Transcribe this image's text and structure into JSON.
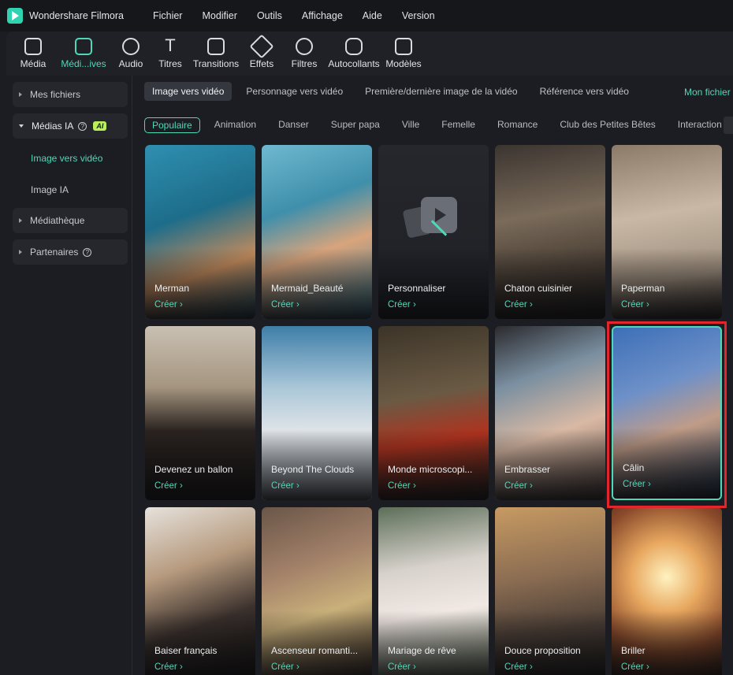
{
  "app": {
    "title": "Wondershare Filmora",
    "accent": "#4fd8b8"
  },
  "menu": [
    "Fichier",
    "Modifier",
    "Outils",
    "Affichage",
    "Aide",
    "Version"
  ],
  "toolbar": [
    {
      "label": "Média",
      "icon": "media-icon"
    },
    {
      "label": "Médi...ives",
      "icon": "stock-media-icon",
      "active": true
    },
    {
      "label": "Audio",
      "icon": "music-note-icon"
    },
    {
      "label": "Titres",
      "icon": "text-icon"
    },
    {
      "label": "Transitions",
      "icon": "transitions-icon"
    },
    {
      "label": "Effets",
      "icon": "effects-icon"
    },
    {
      "label": "Filtres",
      "icon": "filters-icon"
    },
    {
      "label": "Autocollants",
      "icon": "stickers-icon"
    },
    {
      "label": "Modèles",
      "icon": "templates-icon"
    }
  ],
  "sidebar": {
    "mes_fichiers": "Mes fichiers",
    "medias_ia": "Médias IA",
    "ai_badge": "AI",
    "image_vers_video": "Image vers vidéo",
    "image_ia": "Image IA",
    "mediatheque": "Médiathèque",
    "partenaires": "Partenaires",
    "help_glyph": "?"
  },
  "tabs": [
    "Image vers vidéo",
    "Personnage vers vidéo",
    "Première/dernière image de la vidéo",
    "Référence vers vidéo"
  ],
  "tab_right": "Mon fichier",
  "categories": [
    "Populaire",
    "Animation",
    "Danser",
    "Super papa",
    "Ville",
    "Femelle",
    "Romance",
    "Club des Petites Bêtes",
    "Interaction"
  ],
  "create_label": "Créer",
  "cards": [
    {
      "title": "Merman",
      "bg": "linear-gradient(160deg,#2f8fb0 0%,#1d6d8a 40%,#c48b5c 70%,#2a5a6a 100%)"
    },
    {
      "title": "Mermaid_Beauté",
      "bg": "linear-gradient(160deg,#6fb9d0 0%,#3f8fab 35%,#d8a47c 60%,#3d7f96 100%)"
    },
    {
      "title": "Personnaliser",
      "bg": "linear-gradient(180deg,#25272c 0%,#1e2025 100%)",
      "custom": true
    },
    {
      "title": "Chaton cuisinier",
      "bg": "linear-gradient(170deg,#3b3430 0%,#7a6b5a 40%,#4a3f35 70%,#1d1a18 100%)"
    },
    {
      "title": "Paperman",
      "bg": "linear-gradient(170deg,#8b7a68 0%,#c9b8a6 40%,#9f8f7e 75%,#3c352f 100%)"
    },
    {
      "title": "Devenez un ballon",
      "bg": "linear-gradient(180deg,#c9c0b2 0%,#a59580 35%,#2a2320 60%,#1c1816 100%)"
    },
    {
      "title": "Beyond The Clouds",
      "bg": "linear-gradient(180deg,#3e7ea8 0%,#a9c6d8 35%,#dfe4e8 60%,#9aa3aa 100%)"
    },
    {
      "title": "Monde microscopi...",
      "bg": "linear-gradient(170deg,#3c3428 0%,#6a5a44 40%,#b0321e 65%,#2a221b 100%)"
    },
    {
      "title": "Embrasser",
      "bg": "linear-gradient(160deg,#2b2a2e 0%,#7a8fa0 30%,#d9b9a4 60%,#5a4a44 100%)"
    },
    {
      "title": "Câlin",
      "bg": "linear-gradient(160deg,#3d6fb8 0%,#6d90c8 35%,#c09c88 60%,#1f3550 100%)",
      "selected": true
    },
    {
      "title": "Baiser français",
      "bg": "linear-gradient(160deg,#e6e2dc 0%,#b69a7e 35%,#3a302c 65%,#141210 100%)"
    },
    {
      "title": "Ascenseur romanti...",
      "bg": "linear-gradient(160deg,#6a5648 0%,#a4826a 35%,#c9b07a 60%,#3a2c24 100%)"
    },
    {
      "title": "Mariage de rêve",
      "bg": "linear-gradient(170deg,#5c6e58 0%,#d8d2cc 35%,#f1e8e4 60%,#6a7a60 100%)"
    },
    {
      "title": "Douce proposition",
      "bg": "linear-gradient(170deg,#c79a62 0%,#8a6c52 40%,#4a3e36 70%,#201c1a 100%)"
    },
    {
      "title": "Briller",
      "bg": "radial-gradient(circle at 50% 40%,#fff2c0 0%,#e8a860 30%,#8a4a2a 65%,#2a1810 100%)"
    }
  ]
}
